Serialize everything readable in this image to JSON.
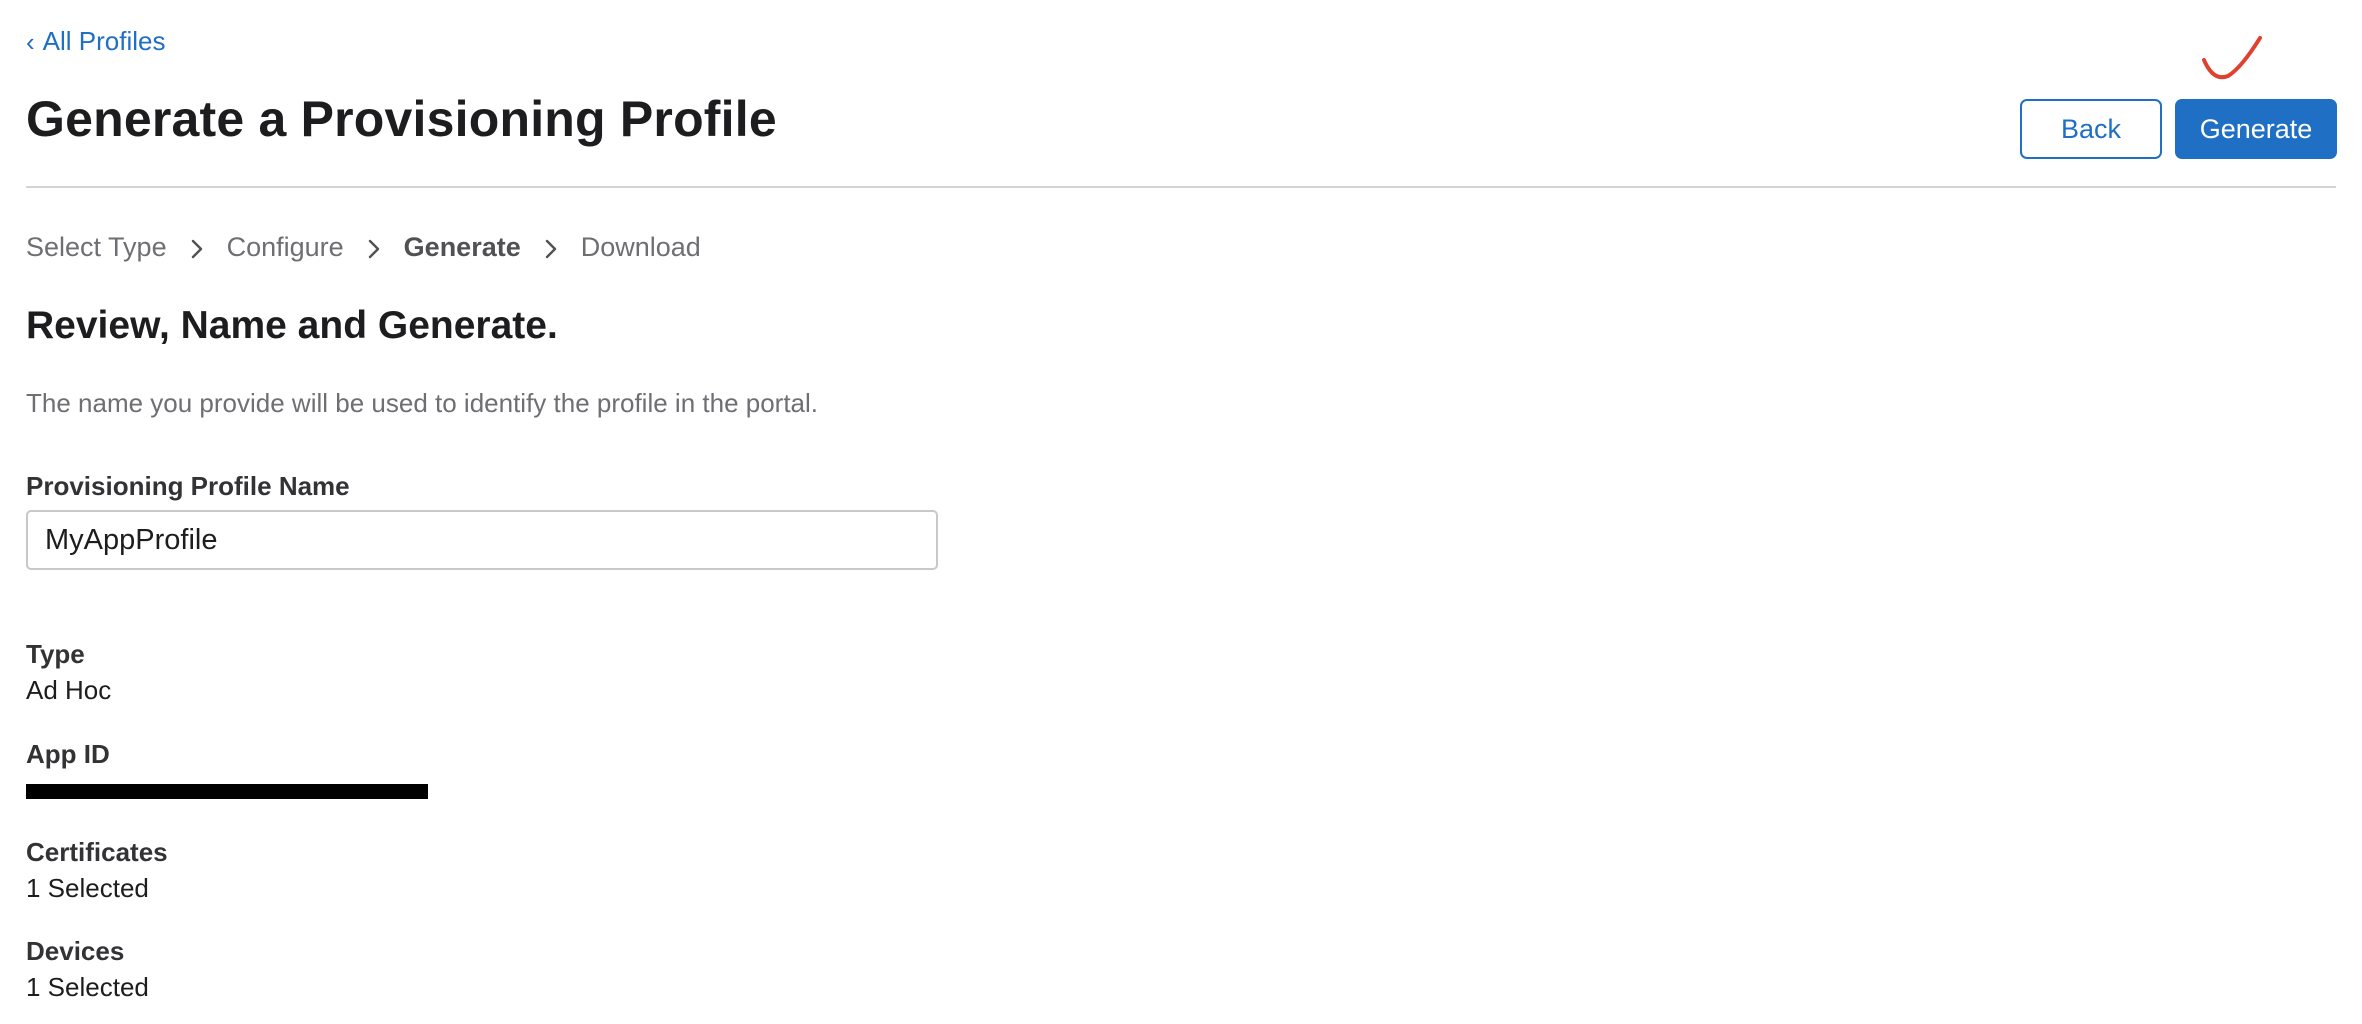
{
  "nav": {
    "back_link_label": "All Profiles",
    "back_link_icon": "chevron-left-icon"
  },
  "header": {
    "title": "Generate a Provisioning Profile",
    "back_button_label": "Back",
    "generate_button_label": "Generate",
    "annotation_mark": "checkmark-icon",
    "annotation_color": "#e0402f"
  },
  "steps": [
    {
      "label": "Select Type",
      "active": false
    },
    {
      "label": "Configure",
      "active": false
    },
    {
      "label": "Generate",
      "active": true
    },
    {
      "label": "Download",
      "active": false
    }
  ],
  "review": {
    "title": "Review, Name and Generate.",
    "description": "The name you provide will be used to identify the profile in the portal."
  },
  "name_field": {
    "label": "Provisioning Profile Name",
    "value": "MyAppProfile"
  },
  "details": {
    "type": {
      "label": "Type",
      "value": "Ad Hoc"
    },
    "app_id": {
      "label": "App ID",
      "redacted": true
    },
    "certificates": {
      "label": "Certificates",
      "value": "1 Selected"
    },
    "devices": {
      "label": "Devices",
      "value": "1 Selected"
    }
  },
  "colors": {
    "accent": "#1f6fc5",
    "text": "#1d1d1f",
    "muted": "#6e6e73",
    "divider": "#d2d2d7"
  }
}
